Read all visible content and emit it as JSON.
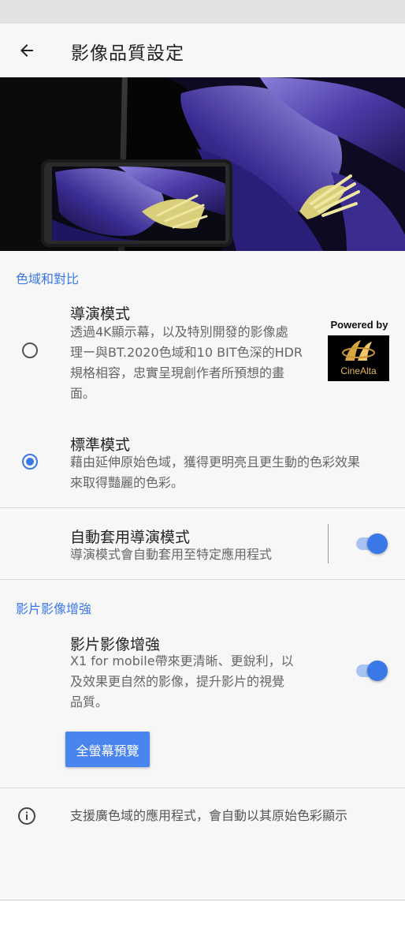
{
  "app": {
    "title": "影像品質設定"
  },
  "colors": {
    "accent": "#3b78e7",
    "section_header": "#3b78e7",
    "button_bg": "#4a85ef"
  },
  "sections": {
    "gamut": {
      "header": "色域和對比",
      "director_mode": {
        "title": "導演模式",
        "desc_lines": [
          "透過4K顯示幕，以及特別開發的影像處",
          "理ー與BT.2020色域和10 BIT色深的HDR",
          "規格相容，忠實呈現創作者所預想的畫",
          "面。"
        ],
        "selected": false
      },
      "standard_mode": {
        "title": "標準模式",
        "desc_lines": [
          "藉由延伸原始色域，獲得更明亮且更生動的色彩效果",
          "來取得豔麗的色彩。"
        ],
        "selected": true
      },
      "auto_director": {
        "title": "自動套用導演模式",
        "desc": "導演模式會自動套用至特定應用程式",
        "enabled": true
      }
    },
    "video": {
      "header": "影片影像增強",
      "enhance": {
        "title": "影片影像增強",
        "desc_lines": [
          "X1 for mobile帶來更清晰、更銳利，以",
          "及效果更自然的影像，提升影片的視覺",
          "品質。"
        ],
        "enabled": true
      },
      "preview_button": "全螢幕預覽"
    }
  },
  "badge": {
    "powered_by": "Powered by",
    "brand": "CineAlta"
  },
  "info": {
    "text": "支援廣色域的應用程式，會自動以其原始色彩顯示"
  },
  "icons": {
    "back": "back-arrow-icon",
    "info": "info-icon"
  }
}
